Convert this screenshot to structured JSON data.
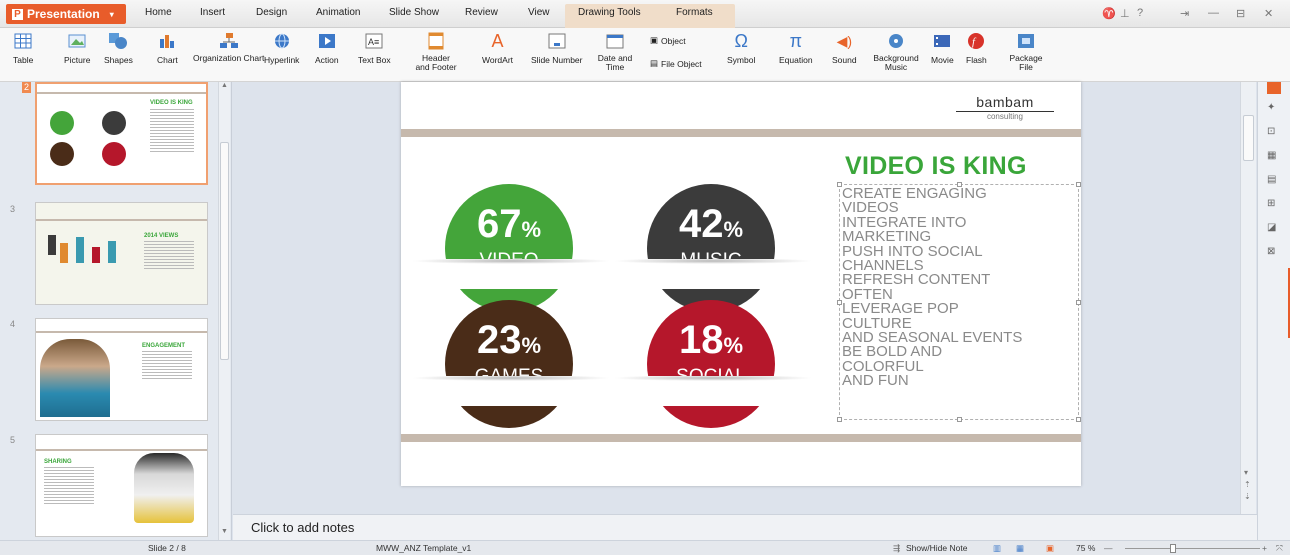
{
  "app": {
    "name": "Presentation",
    "menu_tabs": [
      "Home",
      "Insert",
      "Design",
      "Animation",
      "Slide Show",
      "Review",
      "View"
    ],
    "context_tabs": [
      "Drawing Tools",
      "Formats"
    ],
    "window_controls": [
      "?",
      "—",
      "✕"
    ]
  },
  "ribbon": {
    "table": "Table",
    "picture": "Picture",
    "shapes": "Shapes",
    "chart": "Chart",
    "org_chart": "Organization Chart",
    "hyperlink": "Hyperlink",
    "action": "Action",
    "text_box": "Text Box",
    "header_footer": "Header and Footer",
    "wordart": "WordArt",
    "slide_number": "Slide Number",
    "date_time": "Date and Time",
    "object": "Object",
    "file_object": "File Object",
    "symbol": "Symbol",
    "equation": "Equation",
    "sound": "Sound",
    "background_music": "Background Music",
    "movie": "Movie",
    "flash": "Flash",
    "package_file": "Package File"
  },
  "thumbnails": [
    {
      "num": "2",
      "title": "VIDEO IS KING"
    },
    {
      "num": "3",
      "title": "2014 VIEWS"
    },
    {
      "num": "4",
      "title": "ENGAGEMENT"
    },
    {
      "num": "5",
      "title": "SHARING"
    }
  ],
  "slide": {
    "logo": "bambam",
    "logo_sub": "consulting",
    "headline": "VIDEO IS KING",
    "stats": [
      {
        "value": "67",
        "unit": "%",
        "label": "VIDEO",
        "color": "#44a53a"
      },
      {
        "value": "42",
        "unit": "%",
        "label": "MUSIC",
        "color": "#3b3b3b"
      },
      {
        "value": "23",
        "unit": "%",
        "label": "GAMES",
        "color": "#4a2c18"
      },
      {
        "value": "18",
        "unit": "%",
        "label": "SOCIAL",
        "color": "#b5172b"
      }
    ],
    "bullets": [
      "CREATE ENGAGING",
      "VIDEOS",
      "INTEGRATE INTO",
      "MARKETING",
      "PUSH INTO SOCIAL",
      "CHANNELS",
      "REFRESH CONTENT",
      "OFTEN",
      "LEVERAGE POP",
      "CULTURE",
      "AND SEASONAL EVENTS",
      "BE BOLD AND",
      "COLORFUL",
      "AND FUN"
    ]
  },
  "notes_placeholder": "Click to add notes",
  "status": {
    "slide_counter": "Slide 2 / 8",
    "template": "MWW_ANZ Template_v1",
    "show_hide_note": "Show/Hide Note",
    "zoom": "75 %"
  },
  "colors": {
    "accent": "#e85c2a",
    "green": "#3aa63a",
    "band": "#c6b9ad"
  }
}
